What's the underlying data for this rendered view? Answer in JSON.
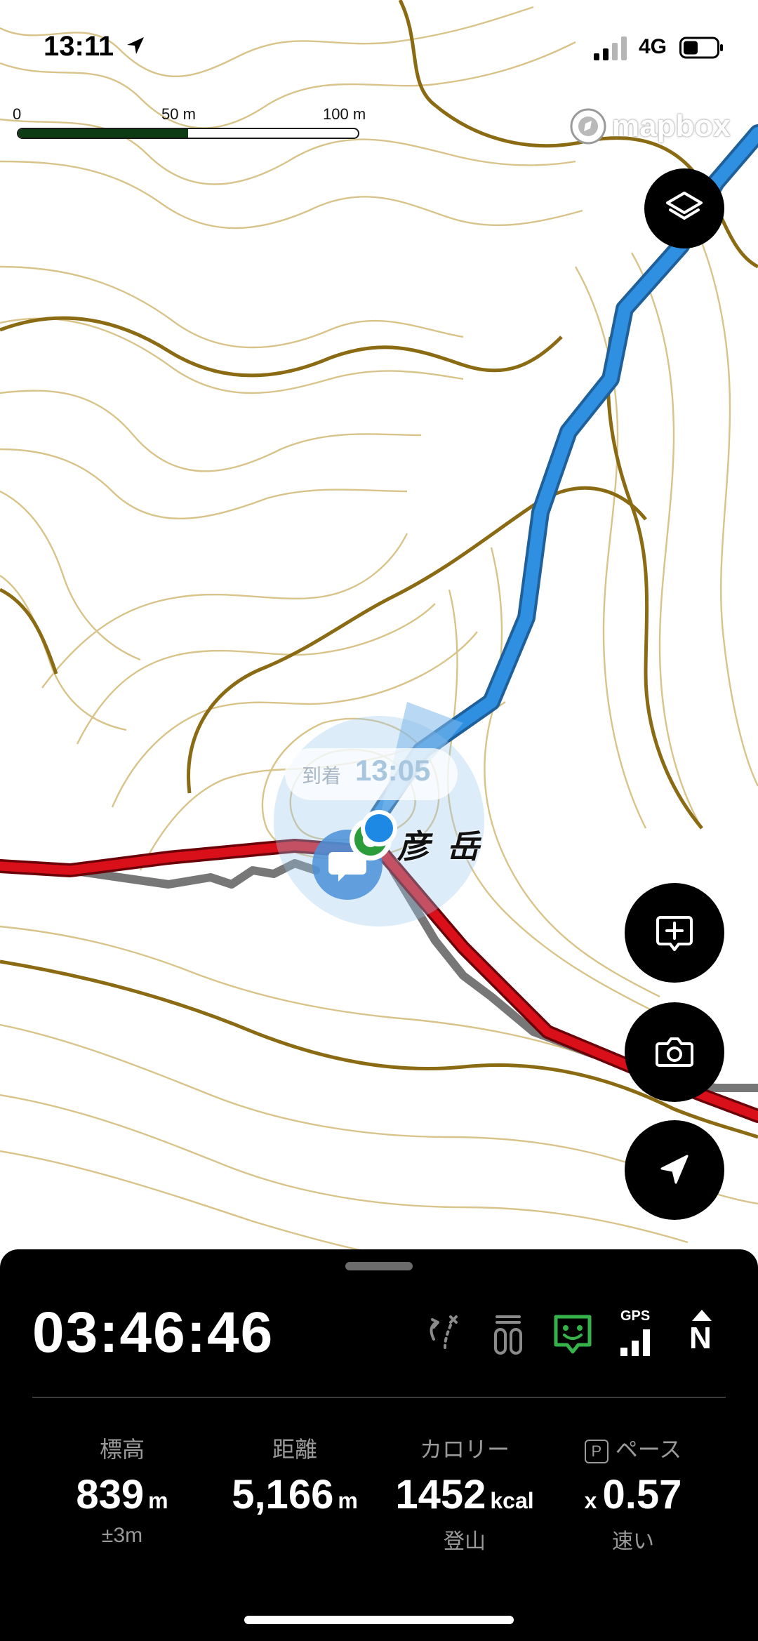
{
  "status_bar": {
    "time": "13:11",
    "network": "4G"
  },
  "scale_bar": {
    "labels": [
      "0",
      "50 m",
      "100 m"
    ],
    "fill_fraction": 0.5
  },
  "attribution": {
    "brand": "mapbox"
  },
  "map": {
    "arrival_label": "到着",
    "arrival_time": "13:05",
    "peak_label": "彦 岳",
    "colors": {
      "contour": "#d8c48a",
      "index_contour": "#8a6a12",
      "planned_route": "#d9101a",
      "walked_route": "#2f8fe0",
      "track_gray": "#777777"
    }
  },
  "controls": {
    "layers": {
      "icon": "layers-icon"
    },
    "add_note": {
      "icon": "add-note-icon"
    },
    "camera": {
      "icon": "camera-icon"
    },
    "locate": {
      "icon": "location-arrow-icon"
    }
  },
  "panel": {
    "elapsed_time": "03:46:46",
    "tool_icons": [
      "route-branch-icon",
      "wearable-icon",
      "smile-badge-icon",
      "gps-signal-icon",
      "north-up-icon"
    ],
    "gps_label": "GPS",
    "north_label": "N",
    "stats": [
      {
        "label": "標高",
        "value": "839",
        "unit": "m",
        "sub": "±3m"
      },
      {
        "label": "距離",
        "value": "5,166",
        "unit": "m",
        "sub": ""
      },
      {
        "label": "カロリー",
        "value": "1452",
        "unit": "kcal",
        "sub": "登山"
      },
      {
        "label": "ペース",
        "prefix": "x",
        "value": "0.57",
        "unit": "",
        "sub": "速い",
        "badge": "P"
      }
    ],
    "accent_color": "#35b34a"
  }
}
